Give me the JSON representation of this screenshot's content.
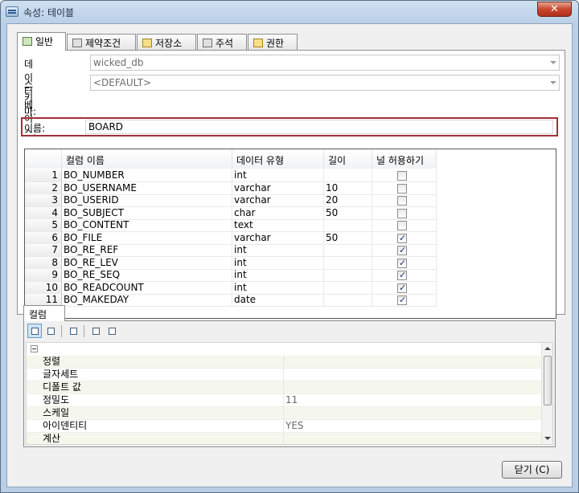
{
  "window": {
    "title": "속성: 테이블",
    "close_glyph": "✕"
  },
  "tabs": [
    {
      "label": "일반",
      "icon": "general-tab-icon"
    },
    {
      "label": "제약조건",
      "icon": "constraint-tab-icon"
    },
    {
      "label": "저장소",
      "icon": "storage-tab-icon"
    },
    {
      "label": "주석",
      "icon": "comment-tab-icon"
    },
    {
      "label": "권한",
      "icon": "permission-tab-icon"
    }
  ],
  "fields": {
    "database": {
      "label": "데이터베이스:",
      "value": "wicked_db"
    },
    "schema": {
      "label": "스키마:",
      "value": "<DEFAULT>"
    },
    "name": {
      "label": "이름:",
      "value": "BOARD"
    }
  },
  "grid": {
    "headers": [
      "컬럼 이름",
      "데이터 유형",
      "길이",
      "널 허용하기"
    ],
    "rows": [
      {
        "num": "1",
        "name": "BO_NUMBER",
        "type": "int",
        "length": "",
        "nullable": false
      },
      {
        "num": "2",
        "name": "BO_USERNAME",
        "type": "varchar",
        "length": "10",
        "nullable": false
      },
      {
        "num": "3",
        "name": "BO_USERID",
        "type": "varchar",
        "length": "20",
        "nullable": false
      },
      {
        "num": "4",
        "name": "BO_SUBJECT",
        "type": "char",
        "length": "50",
        "nullable": false
      },
      {
        "num": "5",
        "name": "BO_CONTENT",
        "type": "text",
        "length": "",
        "nullable": false
      },
      {
        "num": "6",
        "name": "BO_FILE",
        "type": "varchar",
        "length": "50",
        "nullable": true
      },
      {
        "num": "7",
        "name": "BO_RE_REF",
        "type": "int",
        "length": "",
        "nullable": true
      },
      {
        "num": "8",
        "name": "BO_RE_LEV",
        "type": "int",
        "length": "",
        "nullable": true
      },
      {
        "num": "9",
        "name": "BO_RE_SEQ",
        "type": "int",
        "length": "",
        "nullable": true
      },
      {
        "num": "10",
        "name": "BO_READCOUNT",
        "type": "int",
        "length": "",
        "nullable": true
      },
      {
        "num": "11",
        "name": "BO_MAKEDAY",
        "type": "date",
        "length": "",
        "nullable": true
      }
    ]
  },
  "column_panel": {
    "tab_label": "컬럼",
    "toolbar_icons": [
      "categorized-icon",
      "alphabetical-sort-icon",
      "property-pages-icon",
      "expand-icon",
      "collapse-icon"
    ],
    "properties": [
      {
        "name": "정렬",
        "value": ""
      },
      {
        "name": "글자세트",
        "value": ""
      },
      {
        "name": "디폴트 값",
        "value": ""
      },
      {
        "name": "정밀도",
        "value": "11"
      },
      {
        "name": "스케일",
        "value": ""
      },
      {
        "name": "아이덴티티",
        "value": "YES"
      },
      {
        "name": "계산",
        "value": ""
      }
    ]
  },
  "footer": {
    "close_label": "닫기 (C)"
  },
  "colors": {
    "highlight_border": "#a3303a",
    "title_bar": "#b9cfe6",
    "close_button": "#c7462c"
  }
}
